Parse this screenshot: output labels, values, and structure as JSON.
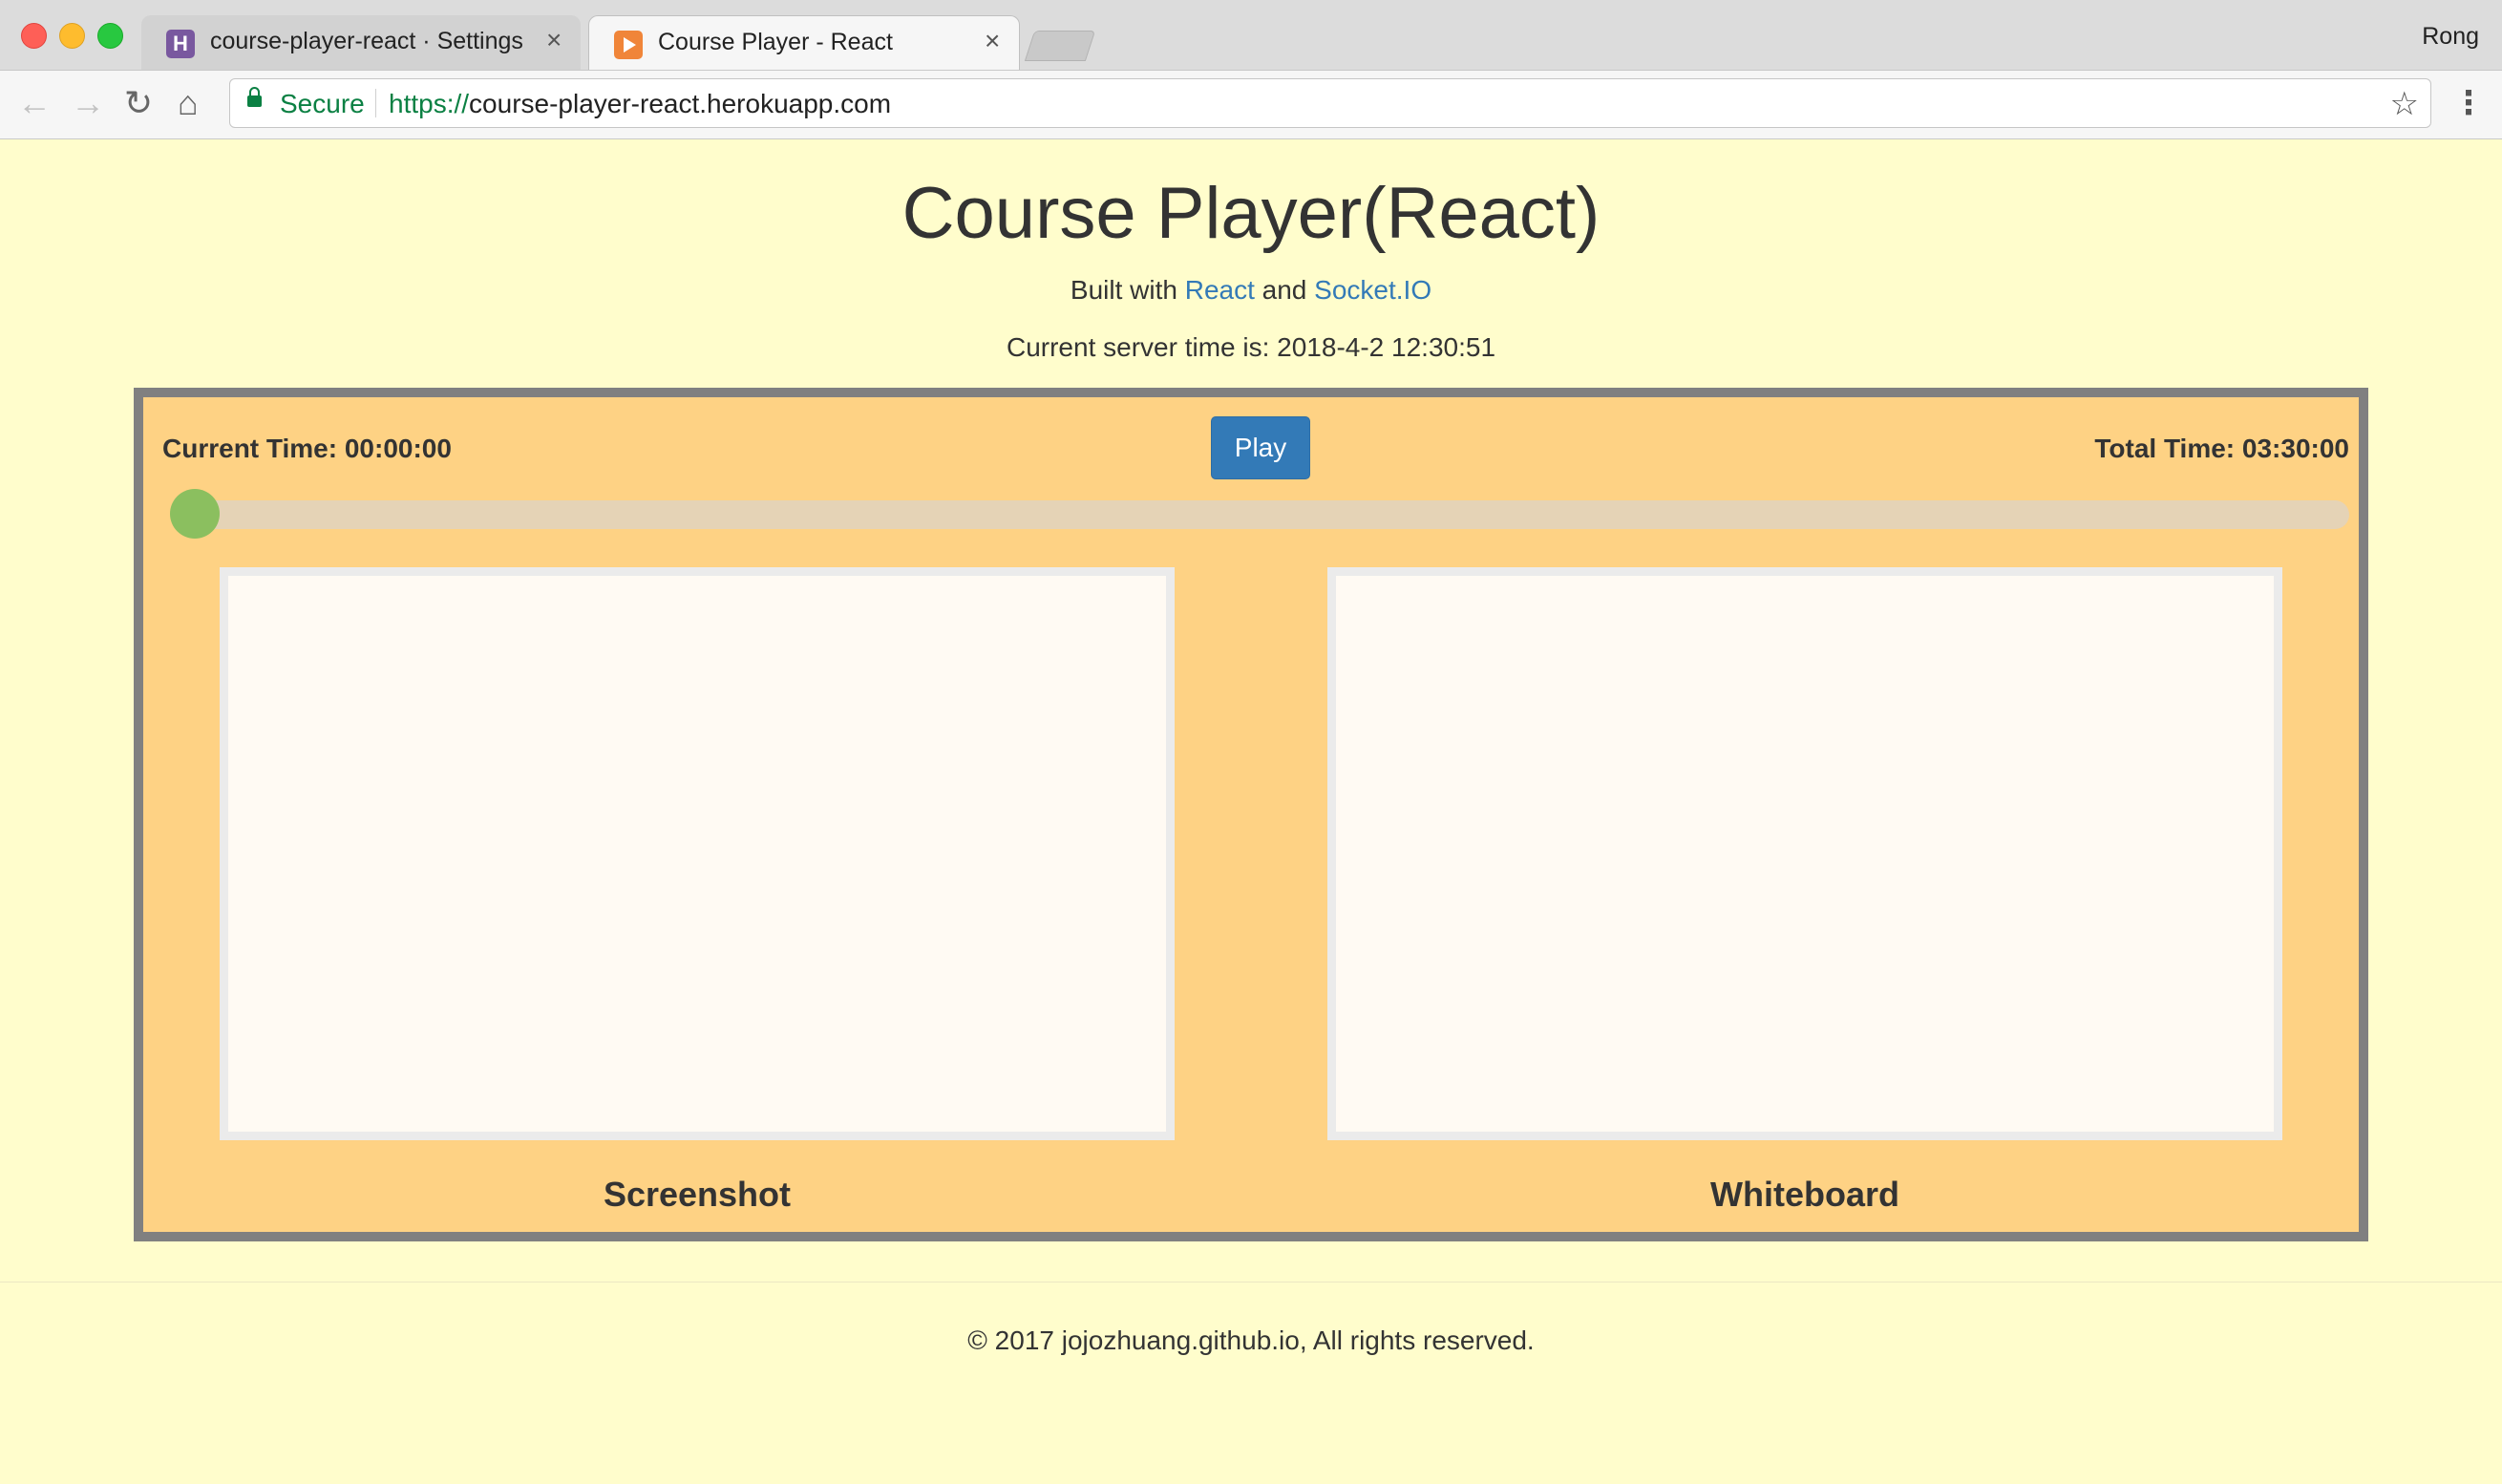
{
  "browser": {
    "tabs": [
      {
        "title": "course-player-react · Settings",
        "icon": "heroku-icon",
        "active": false
      },
      {
        "title": "Course Player - React",
        "icon": "player-icon",
        "active": true
      }
    ],
    "close_glyph": "×",
    "profile_name": "Rong",
    "secure_label": "Secure",
    "url_scheme": "https://",
    "url_host": "course-player-react.herokuapp.com",
    "nav": {
      "back": "←",
      "forward": "→",
      "reload": "↻",
      "home": "⌂",
      "star": "☆",
      "menu": "⋮"
    }
  },
  "page": {
    "title": "Course Player(React)",
    "subtitle_prefix": "Built with ",
    "subtitle_link1": "React",
    "subtitle_middle": " and ",
    "subtitle_link2": "Socket.IO",
    "server_time_text": "Current server time is: 2018-4-2 12:30:51"
  },
  "player": {
    "current_time_text": "Current Time: 00:00:00",
    "total_time_text": "Total Time: 03:30:00",
    "play_label": "Play",
    "progress": 0.0,
    "panels": {
      "left_label": "Screenshot",
      "right_label": "Whiteboard"
    }
  },
  "footer": {
    "text": "© 2017 jojozhuang.github.io, All rights reserved."
  },
  "colors": {
    "page_bg": "#fffdcc",
    "player_bg": "#fed284",
    "player_border": "#808080",
    "play_button": "#337ab7",
    "slider_thumb": "#8bbf5f",
    "link": "#337ab7"
  }
}
